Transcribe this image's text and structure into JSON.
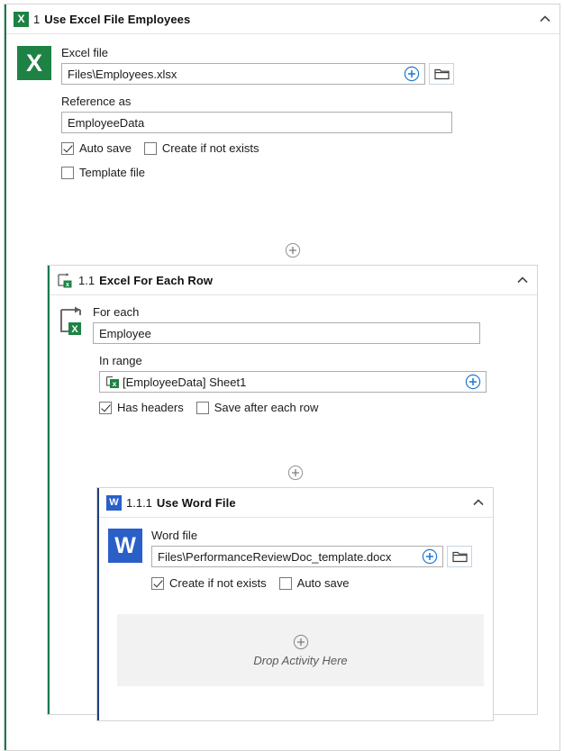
{
  "root_activity": {
    "icon": "excel-icon",
    "step": "1",
    "title": "Use Excel File Employees",
    "collapse_icon": "chevron-up-icon",
    "accent_color": "#1a7a4f",
    "excel_file": {
      "label": "Excel file",
      "value": "Files\\Employees.xlsx",
      "placeholder": "",
      "add_icon": "circle-plus-icon",
      "browse_icon": "folder-icon"
    },
    "reference_as": {
      "label": "Reference as",
      "value": "EmployeeData",
      "placeholder": ""
    },
    "checkboxes": [
      {
        "label": "Auto save",
        "checked": true
      },
      {
        "label": "Create if not exists",
        "checked": false
      },
      {
        "label": "Template file",
        "checked": false
      }
    ]
  },
  "insert_loop": {
    "icon": "circle-plus-icon"
  },
  "loop_activity": {
    "icon": "excel-for-each-row-icon",
    "step": "1.1",
    "title": "Excel For Each Row",
    "collapse_icon": "chevron-up-icon",
    "accent_color": "#1a7a4f",
    "for_each": {
      "label": "For each",
      "value": "Employee",
      "placeholder": "",
      "icon": "loop-excel-icon"
    },
    "in_range": {
      "label": "In range",
      "value": "[EmployeeData] Sheet1",
      "placeholder": "",
      "value_icon": "excel-range-icon",
      "add_icon": "circle-plus-icon"
    },
    "checkboxes": [
      {
        "label": "Has headers",
        "checked": true
      },
      {
        "label": "Save after each row",
        "checked": false
      }
    ]
  },
  "insert_word": {
    "icon": "circle-plus-icon"
  },
  "word_activity": {
    "icon": "word-icon",
    "step": "1.1.1",
    "title": "Use Word File",
    "collapse_icon": "chevron-up-icon",
    "accent_color": "#20407f",
    "word_file": {
      "label": "Word file",
      "value": "Files\\PerformanceReviewDoc_template.docx",
      "placeholder": "",
      "add_icon": "circle-plus-icon",
      "browse_icon": "folder-icon"
    },
    "checkboxes": [
      {
        "label": "Create if not exists",
        "checked": true
      },
      {
        "label": "Auto save",
        "checked": false
      }
    ],
    "dropzone": {
      "icon": "circle-plus-icon",
      "text": "Drop Activity Here"
    }
  },
  "glyphs": {
    "excel_letter": "X",
    "word_letter": "W"
  },
  "colors": {
    "excel_green": "#1e8244",
    "word_blue": "#2a5fc8",
    "accent_plus_blue": "#1f77d0",
    "card_accent_green": "#1a7a4f",
    "card_accent_blue": "#20407f",
    "dropzone_bg": "#f2f2f2"
  }
}
